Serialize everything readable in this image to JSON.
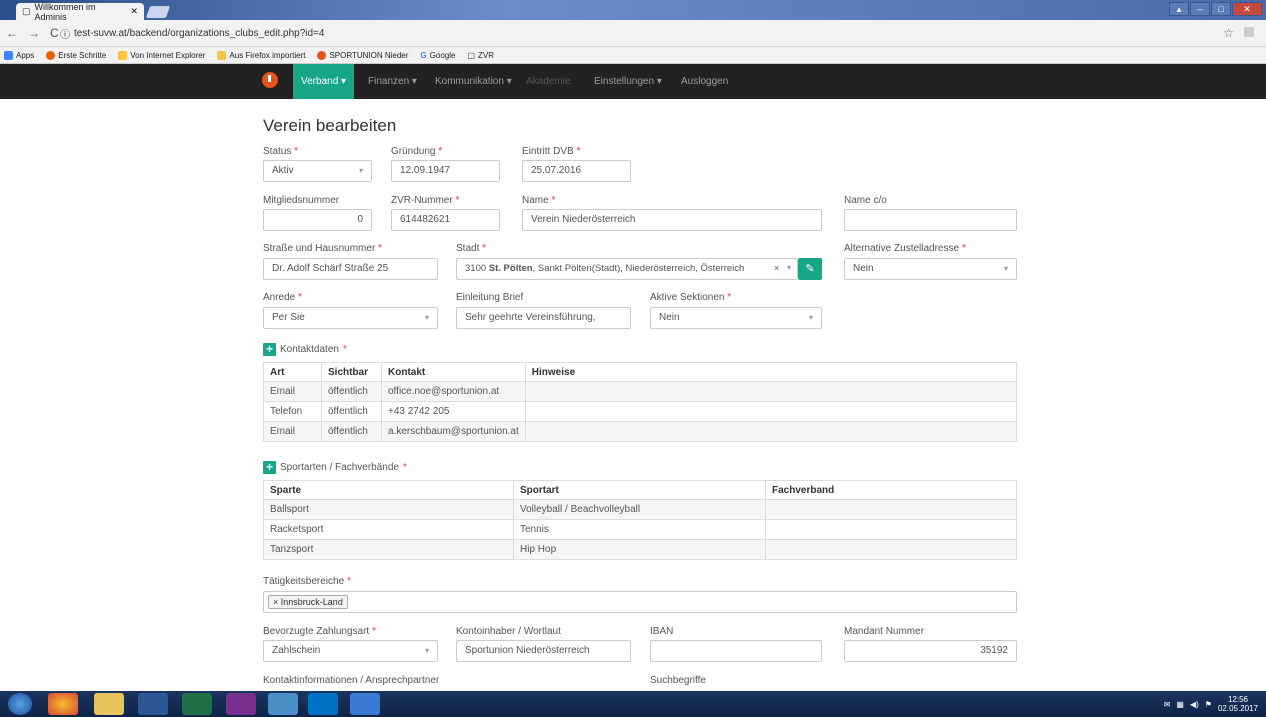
{
  "browser": {
    "tab_title": "Willkommen im Adminis",
    "url": "test-suvw.at/backend/organizations_clubs_edit.php?id=4",
    "bookmarks": [
      "Apps",
      "Erste Schritte",
      "Von Internet Explorer",
      "Aus Firefox importiert",
      "SPORTUNION Nieder",
      "Google",
      "ZVR"
    ]
  },
  "nav": {
    "items": [
      "Verband ▾",
      "Finanzen ▾",
      "Kommunikation ▾",
      "Akademie",
      "Einstellungen ▾",
      "Ausloggen"
    ]
  },
  "form": {
    "title": "Verein bearbeiten",
    "status_label": "Status",
    "status_value": "Aktiv",
    "gruendung_label": "Gründung",
    "gruendung_value": "12.09.1947",
    "eintritt_label": "Eintritt DVB",
    "eintritt_value": "25.07.2016",
    "mitglied_label": "Mitgliedsnummer",
    "mitglied_value": "0",
    "zvr_label": "ZVR-Nummer",
    "zvr_value": "614482621",
    "name_label": "Name",
    "name_value": "Verein Niederösterreich",
    "nameco_label": "Name c/o",
    "nameco_value": "",
    "strasse_label": "Straße und Hausnummer",
    "strasse_value": "Dr. Adolf Schärf Straße 25",
    "stadt_label": "Stadt",
    "stadt_value_bold": "St. Pölten",
    "stadt_value_pre": "3100",
    "stadt_value_post": ", Sankt Pölten(Stadt), Niederösterreich, Österreich",
    "altzu_label": "Alternative Zustelladresse",
    "altzu_value": "Nein",
    "anrede_label": "Anrede",
    "anrede_value": "Per Sie",
    "einleitung_label": "Einleitung Brief",
    "einleitung_value": "Sehr geehrte Vereinsführung,",
    "aktive_label": "Aktive Sektionen",
    "aktive_value": "Nein",
    "kontakt_section": "Kontaktdaten",
    "kontakt_headers": [
      "Art",
      "Sichtbar",
      "Kontakt",
      "Hinweise"
    ],
    "kontakt_rows": [
      [
        "Email",
        "öffentlich",
        "office.noe@sportunion.at",
        ""
      ],
      [
        "Telefon",
        "öffentlich",
        "+43 2742 205",
        ""
      ],
      [
        "Email",
        "öffentlich",
        "a.kerschbaum@sportunion.at",
        ""
      ]
    ],
    "sport_section": "Sportarten / Fachverbände",
    "sport_headers": [
      "Sparte",
      "Sportart",
      "Fachverband"
    ],
    "sport_rows": [
      [
        "Ballsport",
        "Volleyball / Beachvolleyball",
        ""
      ],
      [
        "Racketsport",
        "Tennis",
        ""
      ],
      [
        "Tanzsport",
        "Hip Hop",
        ""
      ]
    ],
    "taetig_label": "Tätigkeitsbereiche",
    "taetig_tag": "Innsbruck-Land",
    "zahlung_label": "Bevorzugte Zahlungsart",
    "zahlung_value": "Zahlschein",
    "konto_label": "Kontoinhaber / Wortlaut",
    "konto_value": "Sportunion Niederösterreich",
    "iban_label": "IBAN",
    "iban_value": "",
    "mandant_label": "Mandant Nummer",
    "mandant_value": "35192",
    "kontaktinfo_label": "Kontaktinformationen / Ansprechpartner",
    "such_label": "Suchbegriffe",
    "required_mark": "*"
  },
  "taskbar": {
    "time": "12:56",
    "date": "02.05.2017"
  },
  "colors": {
    "accent": "#18a689",
    "navbar": "#222222",
    "required": "#e53935"
  }
}
